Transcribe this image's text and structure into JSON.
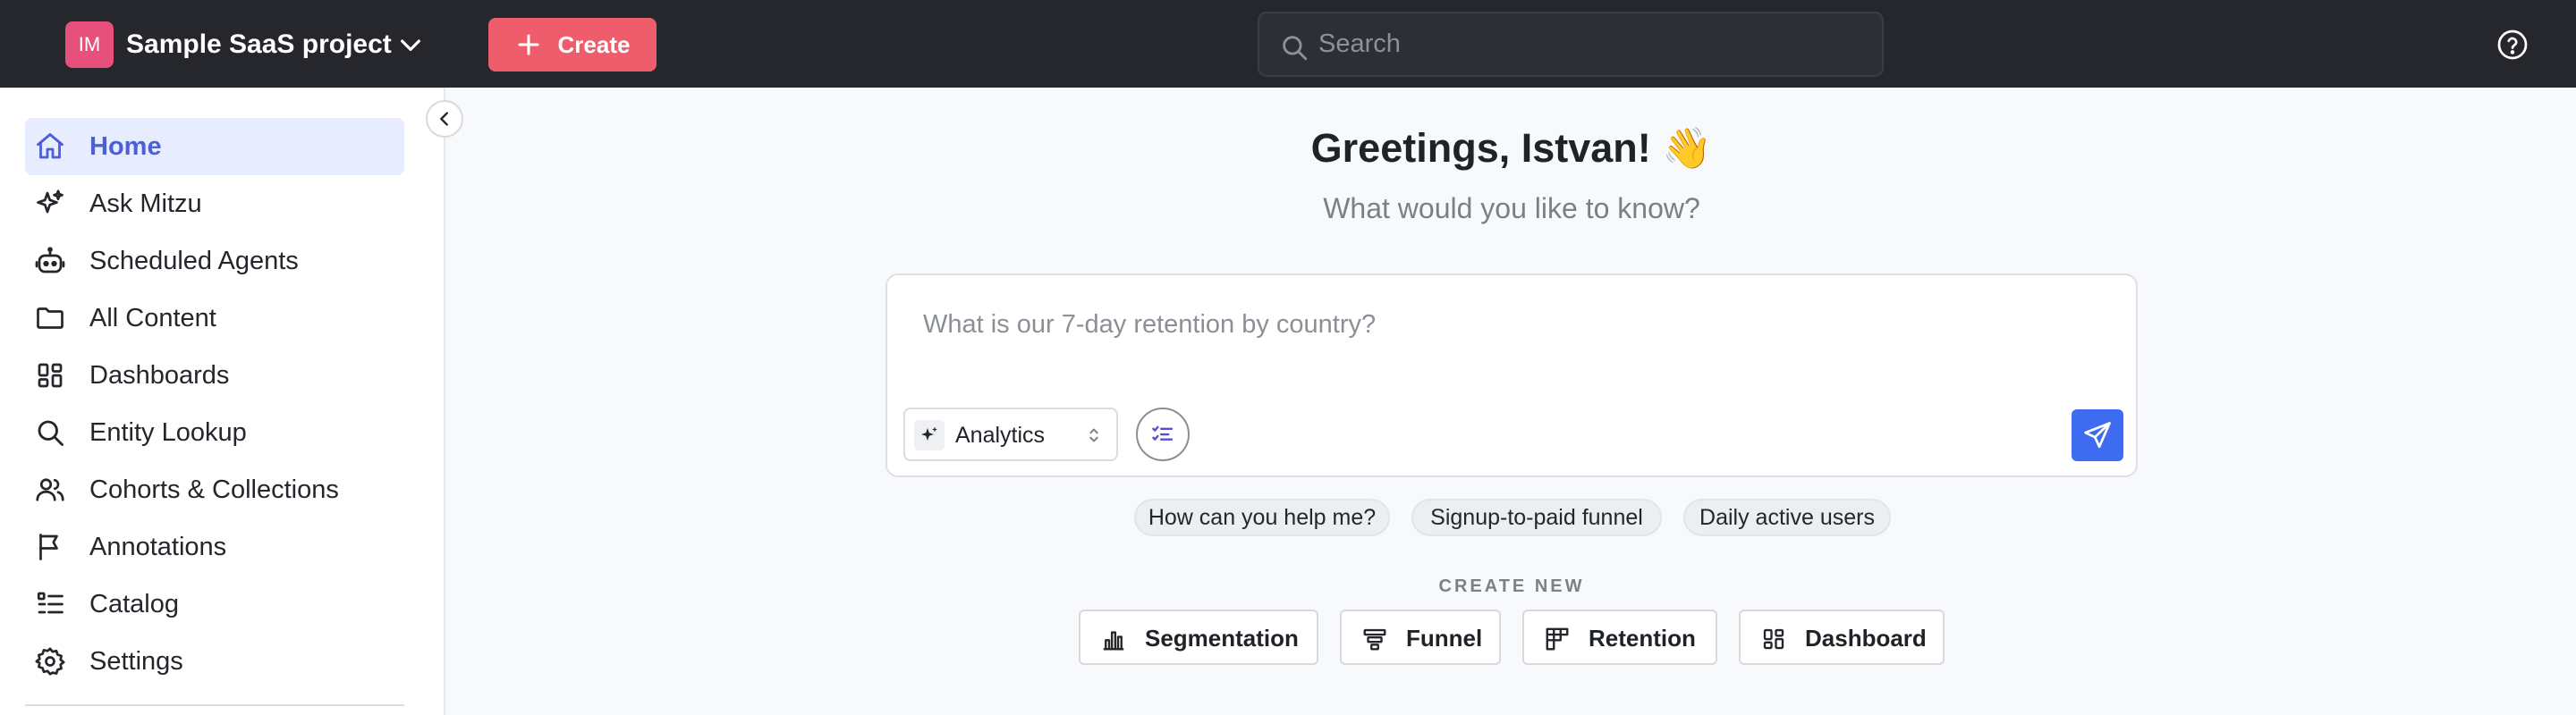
{
  "topbar": {
    "project_initials": "IM",
    "project_name": "Sample SaaS project",
    "create_label": "Create",
    "search_placeholder": "Search",
    "colors": {
      "background": "#25272c",
      "create_button": "#ef5d6c",
      "project_badge": "#e6507a"
    }
  },
  "sidebar": {
    "items": [
      {
        "label": "Home",
        "icon": "home-icon",
        "active": true
      },
      {
        "label": "Ask Mitzu",
        "icon": "sparkles-icon"
      },
      {
        "label": "Scheduled Agents",
        "icon": "robot-icon"
      },
      {
        "label": "All Content",
        "icon": "folder-icon"
      },
      {
        "label": "Dashboards",
        "icon": "dashboard-grid-icon"
      },
      {
        "label": "Entity Lookup",
        "icon": "search-icon"
      },
      {
        "label": "Cohorts & Collections",
        "icon": "users-icon"
      },
      {
        "label": "Annotations",
        "icon": "flag-icon"
      },
      {
        "label": "Catalog",
        "icon": "list-icon"
      },
      {
        "label": "Settings",
        "icon": "gear-icon"
      }
    ],
    "active_color": "#4b5fd6"
  },
  "main": {
    "greeting": "Greetings, Istvan! 👋",
    "subtitle": "What would you like to know?",
    "ask": {
      "placeholder": "What is our 7-day retention by country?",
      "mode": "Analytics",
      "send_color": "#3f6bf0"
    },
    "suggestions": [
      "How can you help me?",
      "Signup-to-paid funnel",
      "Daily active users"
    ],
    "create_new": {
      "title": "CREATE NEW",
      "buttons": [
        {
          "label": "Segmentation",
          "icon": "bar-chart-icon"
        },
        {
          "label": "Funnel",
          "icon": "funnel-icon"
        },
        {
          "label": "Retention",
          "icon": "retention-grid-icon"
        },
        {
          "label": "Dashboard",
          "icon": "dashboard-grid-icon"
        }
      ]
    }
  }
}
